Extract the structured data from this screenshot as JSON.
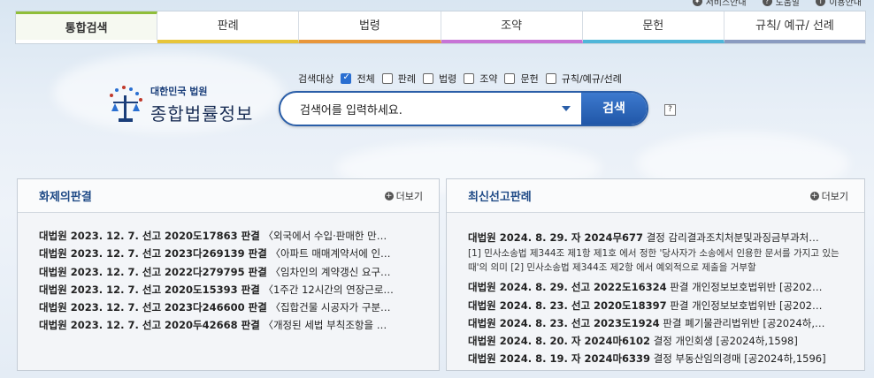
{
  "utility": [
    {
      "icon": "settings-icon",
      "label": "서비스안내"
    },
    {
      "icon": "help-icon",
      "label": "도움말"
    },
    {
      "icon": "guide-icon",
      "label": "이용안내"
    }
  ],
  "tabs": [
    {
      "label": "통합검색",
      "color": "#8fbe3a"
    },
    {
      "label": "판례",
      "color": "#e7c53a"
    },
    {
      "label": "법령",
      "color": "#e8963a"
    },
    {
      "label": "조약",
      "color": "#c774d6"
    },
    {
      "label": "문헌",
      "color": "#4fb6d9"
    },
    {
      "label": "규칙/ 예규/ 선례",
      "color": "#8a9bc0"
    }
  ],
  "logo": {
    "line1": "대한민국 법원",
    "line2": "종합법률정보"
  },
  "filters": {
    "label": "검색대상",
    "items": [
      {
        "label": "전체",
        "checked": true
      },
      {
        "label": "판례",
        "checked": false
      },
      {
        "label": "법령",
        "checked": false
      },
      {
        "label": "조약",
        "checked": false
      },
      {
        "label": "문헌",
        "checked": false
      },
      {
        "label": "규칙/예규/선례",
        "checked": false
      }
    ]
  },
  "search": {
    "placeholder": "검색어를 입력하세요.",
    "button": "검색",
    "help": "?"
  },
  "panels": {
    "left": {
      "title": "화제의판결",
      "more": "더보기",
      "items": [
        {
          "head": "대법원 2023. 12. 7. 선고 2020도17863 판결",
          "text": " 〈외국에서 수입·판매한 만…"
        },
        {
          "head": "대법원 2023. 12. 7. 선고 2023다269139 판결",
          "text": " 〈아파트 매매계약서에 인…"
        },
        {
          "head": "대법원 2023. 12. 7. 선고 2022다279795 판결",
          "text": " 〈임차인의 계약갱신 요구…"
        },
        {
          "head": "대법원 2023. 12. 7. 선고 2020도15393 판결",
          "text": " 〈1주간 12시간의 연장근로…"
        },
        {
          "head": "대법원 2023. 12. 7. 선고 2023다246600 판결",
          "text": " 〈집합건물 시공자가 구분…"
        },
        {
          "head": "대법원 2023. 12. 7. 선고 2020두42668 판결",
          "text": " 〈개정된 세법 부칙조항을 …"
        }
      ]
    },
    "right": {
      "title": "최신선고판례",
      "more": "더보기",
      "first": {
        "head": "대법원 2024. 8. 29. 자 2024무677",
        "text": " 결정 감리결과조치처분및과징금부과처…"
      },
      "first_sub": "[1] 민사소송법 제344조 제1항 제1호 에서 정한 '당사자가 소송에서 인용한 문서를 가지고 있는 때'의 의미 [2] 민사소송법 제344조 제2항 에서 예외적으로 제출을 거부할",
      "items": [
        {
          "head": "대법원 2024. 8. 29. 선고 2022도16324",
          "text": " 판결 개인정보보호법위반 [공202…"
        },
        {
          "head": "대법원 2024. 8. 23. 선고 2020도18397",
          "text": " 판결 개인정보보호법위반 [공202…"
        },
        {
          "head": "대법원 2024. 8. 23. 선고 2023도1924",
          "text": " 판결 폐기물관리법위반 [공2024하,…"
        },
        {
          "head": "대법원 2024. 8. 20. 자 2024마6102",
          "text": " 결정 개인회생 [공2024하,1598]"
        },
        {
          "head": "대법원 2024. 8. 19. 자 2024마6339",
          "text": " 결정 부동산임의경매 [공2024하,1596]"
        }
      ]
    }
  }
}
